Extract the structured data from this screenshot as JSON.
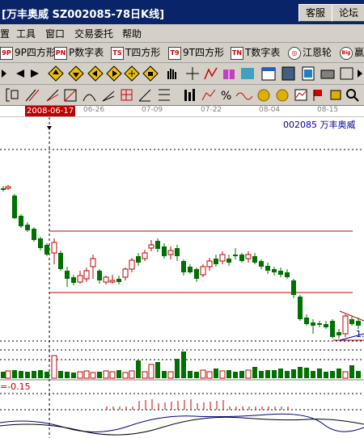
{
  "window": {
    "title": "[万丰奥威   SZ002085-78日K线]",
    "btn_service": "客服",
    "btn_forum": "论坛"
  },
  "menu": [
    "置",
    "工具",
    "窗口",
    "交易委托",
    "帮助"
  ],
  "toolbar_tabs": [
    {
      "icon": "9P",
      "label": "9P四方形"
    },
    {
      "icon": "PN",
      "label": "P数字表"
    },
    {
      "icon": "TS",
      "label": "T四方形"
    },
    {
      "icon": "T9",
      "label": "9T四方形"
    },
    {
      "icon": "TN",
      "label": "T数字表"
    },
    {
      "icon": "◎",
      "label": "江恩轮"
    },
    {
      "icon": "Big",
      "label": "赢"
    }
  ],
  "date_axis": {
    "selected": "2008-06-17",
    "ticks": [
      "06-26",
      "07-09",
      "07-22",
      "08-04",
      "08-15"
    ]
  },
  "stock_label": "002085  万丰奥威",
  "indicator_text": "=-0.15",
  "price_label": "1.",
  "colors": {
    "up": "#c00000",
    "down": "#007000",
    "hline": "#c00000",
    "macd": "#000080"
  }
}
